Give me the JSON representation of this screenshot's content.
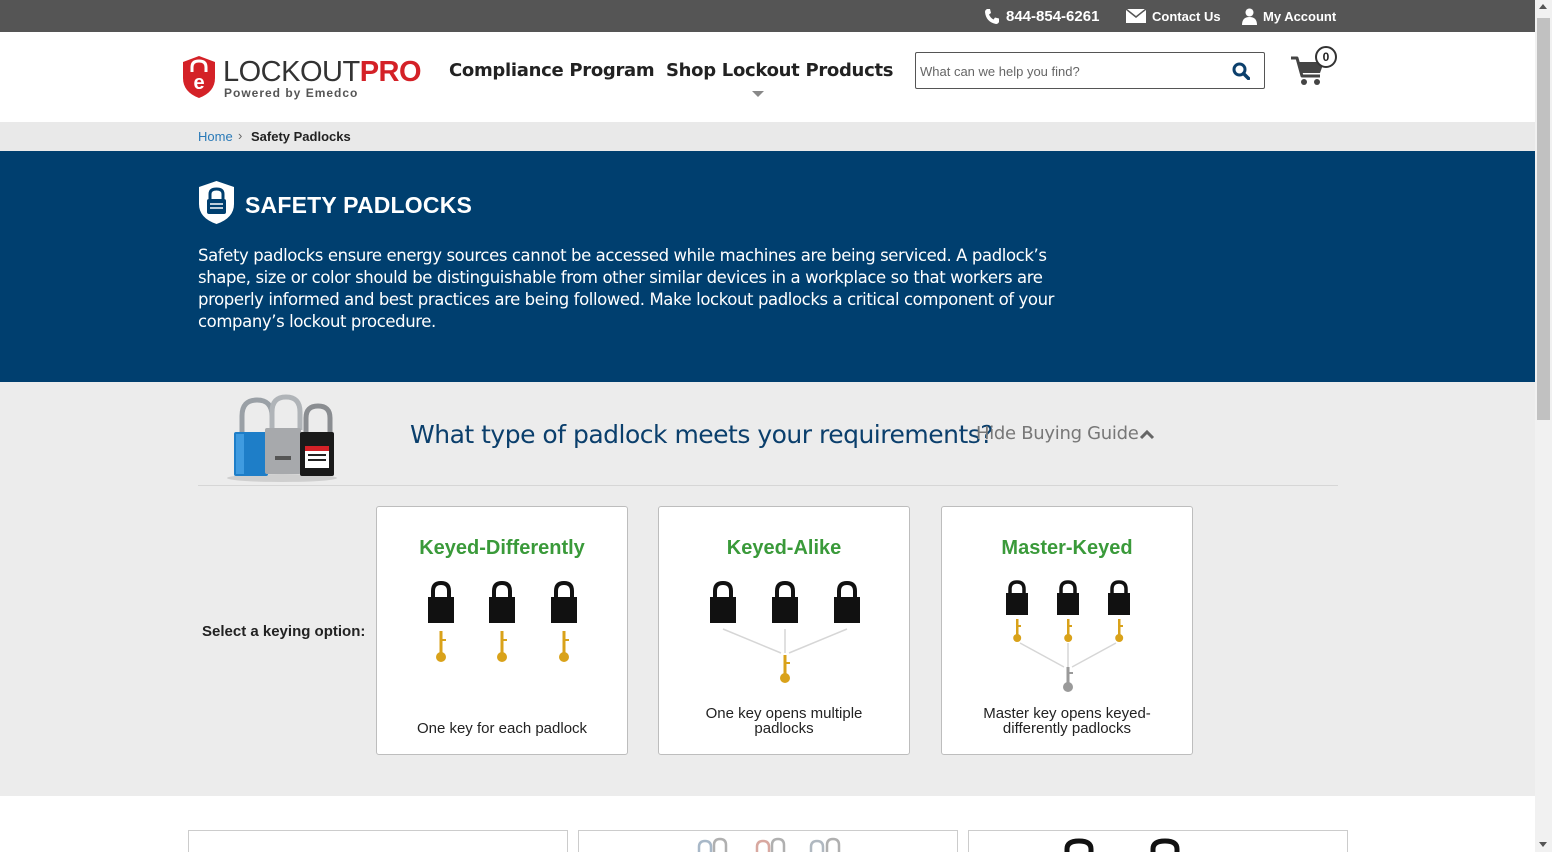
{
  "topbar": {
    "phone": "844-854-6261",
    "contact": "Contact Us",
    "account": "My Account"
  },
  "header": {
    "logo_main": "LOCKOUT",
    "logo_accent": "PRO",
    "logo_sub": "Powered by Emedco",
    "nav": [
      "Compliance Program",
      "Shop Lockout Products"
    ],
    "search_placeholder": "What can we help you find?",
    "cart_count": "0"
  },
  "breadcrumb": {
    "home": "Home",
    "separator": "›",
    "current": "Safety Padlocks"
  },
  "hero": {
    "title": "SAFETY PADLOCKS",
    "description": "Safety padlocks ensure energy sources cannot be accessed while machines are being serviced. A padlock’s shape, size or color should be distinguishable from other similar devices in a workplace so that workers are properly informed and best practices are being followed. Make lockout padlocks a critical component of your company’s lockout procedure."
  },
  "guide": {
    "question": "What type of padlock meets your requirements?",
    "hide_label": "Hide Buying Guide",
    "select_label": "Select a keying option:",
    "options": [
      {
        "title": "Keyed-Differently",
        "description": "One key for each padlock"
      },
      {
        "title": "Keyed-Alike",
        "description": "One key opens multiple padlocks"
      },
      {
        "title": "Master-Keyed",
        "description": "Master key opens keyed-differently padlocks"
      }
    ]
  },
  "colors": {
    "topbar": "#555555",
    "hero": "#003f6f",
    "brand_red": "#d42127",
    "option_green": "#3a9a3a",
    "link_blue": "#2a7ab8",
    "key_gold": "#d9a21a"
  }
}
